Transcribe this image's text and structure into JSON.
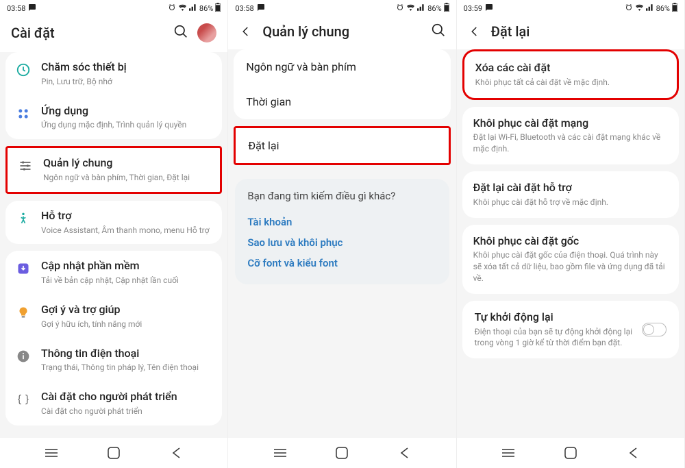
{
  "status": {
    "time1": "03:58",
    "time2": "03:58",
    "time3": "03:59",
    "battery": "86%"
  },
  "screen1": {
    "title": "Cài đặt",
    "items": {
      "device_care": {
        "title": "Chăm sóc thiết bị",
        "sub": "Pin, Lưu trữ, Bộ nhớ"
      },
      "apps": {
        "title": "Ứng dụng",
        "sub": "Ứng dụng mặc định, Trình quản lý quyền"
      },
      "general": {
        "title": "Quản lý chung",
        "sub": "Ngôn ngữ và bàn phím, Thời gian, Đặt lại"
      },
      "accessibility": {
        "title": "Hỗ trợ",
        "sub": "Voice Assistant, Âm thanh mono, menu Hỗ trợ"
      },
      "update": {
        "title": "Cập nhật phần mềm",
        "sub": "Tải về bản cập nhật, Cập nhật lần cuối"
      },
      "tips": {
        "title": "Gợi ý và trợ giúp",
        "sub": "Gợi ý hữu ích, tính năng mới"
      },
      "about": {
        "title": "Thông tin điện thoại",
        "sub": "Trạng thái, Thông tin pháp lý, Tên điện thoại"
      },
      "dev": {
        "title": "Cài đặt cho người phát triển",
        "sub": "Cài đặt cho người phát triển"
      }
    }
  },
  "screen2": {
    "title": "Quản lý chung",
    "lang": "Ngôn ngữ và bàn phím",
    "time": "Thời gian",
    "reset": "Đặt lại",
    "suggest_title": "Bạn đang tìm kiếm điều gì khác?",
    "link1": "Tài khoản",
    "link2": "Sao lưu và khôi phục",
    "link3": "Cỡ font và kiểu font"
  },
  "screen3": {
    "title": "Đặt lại",
    "reset_settings": {
      "title": "Xóa các cài đặt",
      "sub": "Khôi phục tất cả cài đặt về mặc định."
    },
    "reset_network": {
      "title": "Khôi phục cài đặt mạng",
      "sub": "Đặt lại Wi-Fi, Bluetooth và các cài đặt mạng khác về mặc định."
    },
    "reset_access": {
      "title": "Đặt lại cài đặt hỗ trợ",
      "sub": "Khôi phục cài đặt hỗ trợ về mặc định."
    },
    "factory": {
      "title": "Khôi phục cài đặt gốc",
      "sub": "Khôi phục cài đặt gốc của điện thoại. Quá trình này sẽ xóa tất cả dữ liệu, bao gồm file và ứng dụng đã tải về."
    },
    "auto_restart": {
      "title": "Tự khởi động lại",
      "sub": "Điện thoại của bạn sẽ tự động khởi động lại trong vòng 1 giờ kể từ thời điểm bạn đặt."
    }
  }
}
